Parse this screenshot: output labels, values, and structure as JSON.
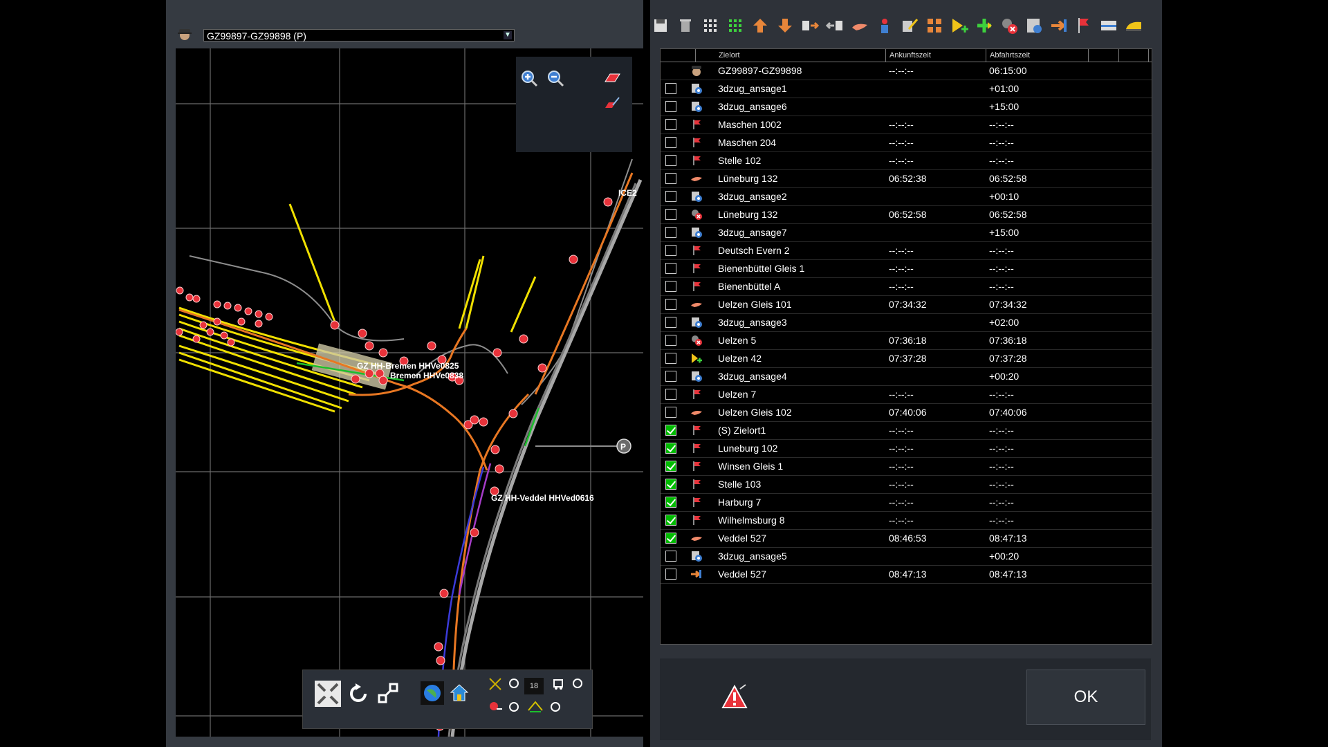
{
  "map": {
    "train_selector": "GZ99897-GZ99898 (P)",
    "zoom_level": "18",
    "labels": {
      "label1": "GZ HH-Bremen HHVe0825",
      "label2": "Bremen HHVe0838",
      "label3": "GZ HH-Veddel HHVed0616",
      "label4": "ICE2"
    }
  },
  "timetable": {
    "columns": {
      "place": "Zielort",
      "arrival": "Ankunftszeit",
      "departure": "Abfahrtszeit"
    },
    "rows": [
      {
        "icon": "driver-icon",
        "place": "GZ99897-GZ99898",
        "arrival": "--:--:--",
        "departure": "06:15:00",
        "checkbox": false,
        "checked": false
      },
      {
        "icon": "script-gear-icon",
        "place": "3dzug_ansage1",
        "arrival": "",
        "departure": "+01:00",
        "checkbox": true,
        "checked": false
      },
      {
        "icon": "script-gear-icon",
        "place": "3dzug_ansage6",
        "arrival": "",
        "departure": "+15:00",
        "checkbox": true,
        "checked": false
      },
      {
        "icon": "red-flag-icon",
        "place": "Maschen 1002",
        "arrival": "--:--:--",
        "departure": "--:--:--",
        "checkbox": true,
        "checked": false
      },
      {
        "icon": "red-flag-icon",
        "place": "Maschen 204",
        "arrival": "--:--:--",
        "departure": "--:--:--",
        "checkbox": true,
        "checked": false
      },
      {
        "icon": "red-flag-icon",
        "place": "Stelle 102",
        "arrival": "--:--:--",
        "departure": "--:--:--",
        "checkbox": true,
        "checked": false
      },
      {
        "icon": "hand-stop-icon",
        "place": "Lüneburg 132",
        "arrival": "06:52:38",
        "departure": "06:52:58",
        "checkbox": true,
        "checked": false
      },
      {
        "icon": "script-gear-icon",
        "place": "3dzug_ansage2",
        "arrival": "",
        "departure": "+00:10",
        "checkbox": true,
        "checked": false
      },
      {
        "icon": "uncouple-icon",
        "place": "Lüneburg 132",
        "arrival": "06:52:58",
        "departure": "06:52:58",
        "checkbox": true,
        "checked": false
      },
      {
        "icon": "script-gear-icon",
        "place": "3dzug_ansage7",
        "arrival": "",
        "departure": "+15:00",
        "checkbox": true,
        "checked": false
      },
      {
        "icon": "red-flag-icon",
        "place": "Deutsch Evern 2",
        "arrival": "--:--:--",
        "departure": "--:--:--",
        "checkbox": true,
        "checked": false
      },
      {
        "icon": "red-flag-icon",
        "place": "Bienenbüttel Gleis 1",
        "arrival": "--:--:--",
        "departure": "--:--:--",
        "checkbox": true,
        "checked": false
      },
      {
        "icon": "red-flag-icon",
        "place": "Bienenbüttel A",
        "arrival": "--:--:--",
        "departure": "--:--:--",
        "checkbox": true,
        "checked": false
      },
      {
        "icon": "hand-stop-icon",
        "place": "Uelzen Gleis 101",
        "arrival": "07:34:32",
        "departure": "07:34:32",
        "checkbox": true,
        "checked": false
      },
      {
        "icon": "script-gear-icon",
        "place": "3dzug_ansage3",
        "arrival": "",
        "departure": "+02:00",
        "checkbox": true,
        "checked": false
      },
      {
        "icon": "uncouple-icon",
        "place": "Uelzen 5",
        "arrival": "07:36:18",
        "departure": "07:36:18",
        "checkbox": true,
        "checked": false
      },
      {
        "icon": "add-wagon-icon",
        "place": "Uelzen 42",
        "arrival": "07:37:28",
        "departure": "07:37:28",
        "checkbox": true,
        "checked": false
      },
      {
        "icon": "script-gear-icon",
        "place": "3dzug_ansage4",
        "arrival": "",
        "departure": "+00:20",
        "checkbox": true,
        "checked": false
      },
      {
        "icon": "red-flag-icon",
        "place": "Uelzen 7",
        "arrival": "--:--:--",
        "departure": "--:--:--",
        "checkbox": true,
        "checked": false
      },
      {
        "icon": "hand-stop-icon",
        "place": "Uelzen Gleis 102",
        "arrival": "07:40:06",
        "departure": "07:40:06",
        "checkbox": true,
        "checked": false
      },
      {
        "icon": "red-flag-icon",
        "place": "(S) Zielort1",
        "arrival": "--:--:--",
        "departure": "--:--:--",
        "checkbox": true,
        "checked": true
      },
      {
        "icon": "red-flag-icon",
        "place": "Luneburg 102",
        "arrival": "--:--:--",
        "departure": "--:--:--",
        "checkbox": true,
        "checked": true
      },
      {
        "icon": "red-flag-icon",
        "place": "Winsen Gleis 1",
        "arrival": "--:--:--",
        "departure": "--:--:--",
        "checkbox": true,
        "checked": true
      },
      {
        "icon": "red-flag-icon",
        "place": "Stelle 103",
        "arrival": "--:--:--",
        "departure": "--:--:--",
        "checkbox": true,
        "checked": true
      },
      {
        "icon": "red-flag-icon",
        "place": "Harburg 7",
        "arrival": "--:--:--",
        "departure": "--:--:--",
        "checkbox": true,
        "checked": true
      },
      {
        "icon": "red-flag-icon",
        "place": "Wilhelmsburg 8",
        "arrival": "--:--:--",
        "departure": "--:--:--",
        "checkbox": true,
        "checked": true
      },
      {
        "icon": "hand-stop-icon",
        "place": "Veddel 527",
        "arrival": "08:46:53",
        "departure": "08:47:13",
        "checkbox": true,
        "checked": true
      },
      {
        "icon": "script-gear-icon",
        "place": "3dzug_ansage5",
        "arrival": "",
        "departure": "+00:20",
        "checkbox": true,
        "checked": false
      },
      {
        "icon": "transfer-arrow-icon",
        "place": "Veddel 527",
        "arrival": "08:47:13",
        "departure": "08:47:13",
        "checkbox": true,
        "checked": false
      }
    ]
  },
  "footer": {
    "ok_label": "OK"
  },
  "colors": {
    "accent": "#e8323a",
    "track_yellow": "#f0e000",
    "track_orange": "#e87722",
    "track_grey": "#9a9a9a",
    "check_green": "#0b0"
  }
}
